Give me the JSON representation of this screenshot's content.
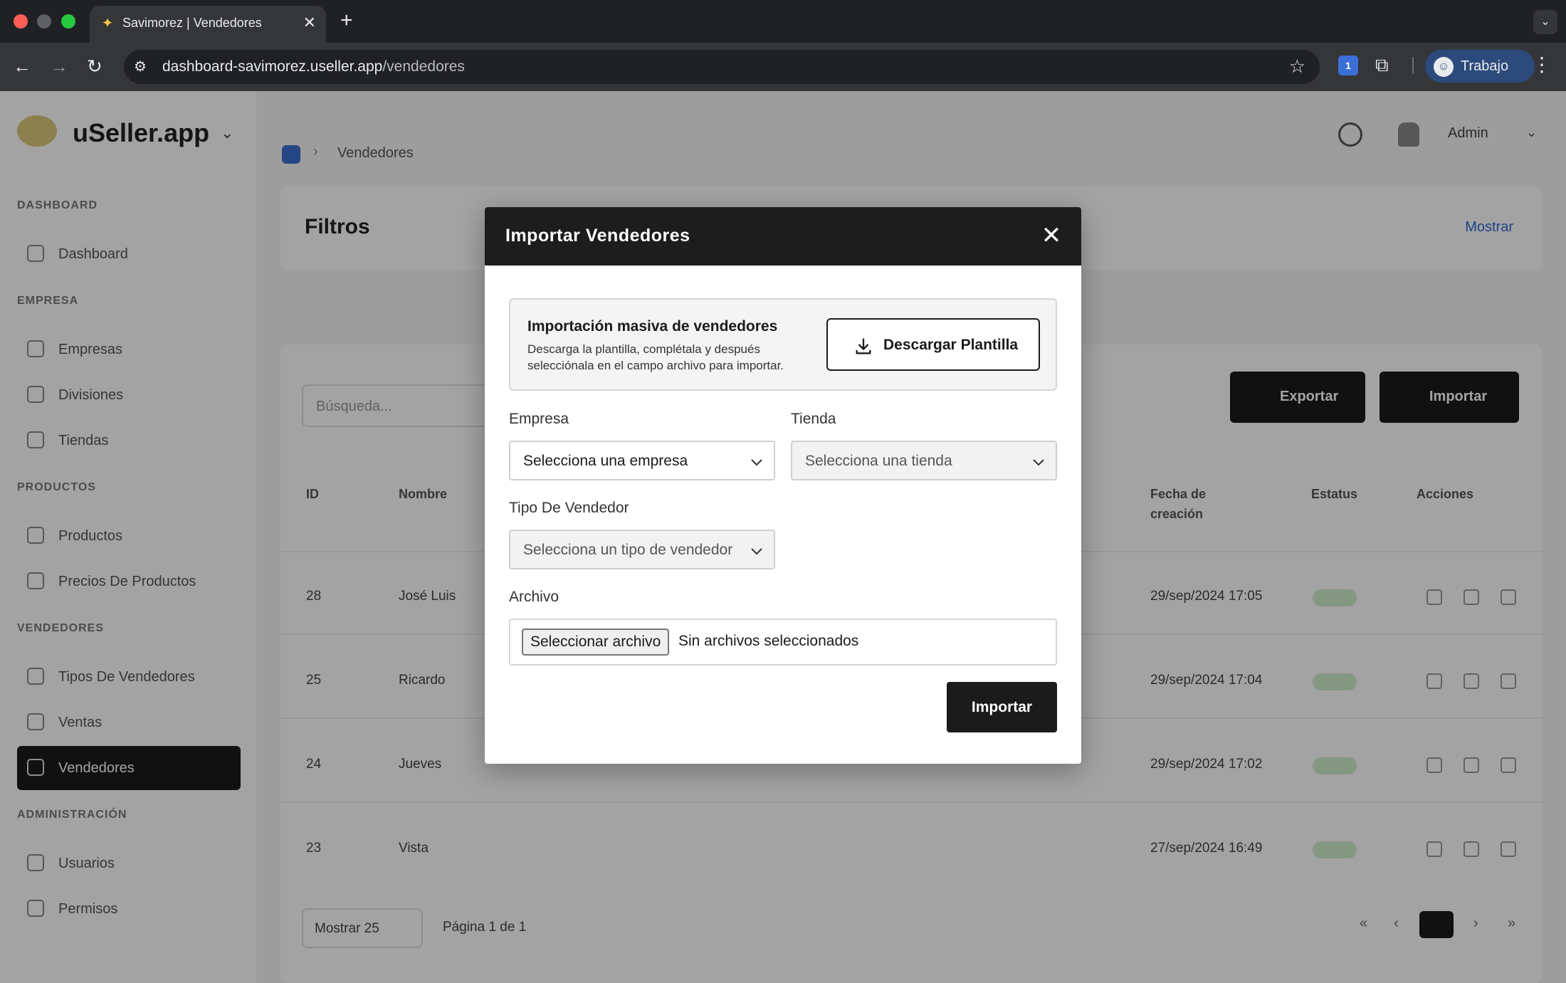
{
  "browser": {
    "tab_title": "Savimorez | Vendedores",
    "tab_close": "✕",
    "new_tab": "+",
    "url_host": "dashboard-savimorez.useller.app",
    "url_path": "/vendedores",
    "profile_label": "Trabajo",
    "extension_badge": "1"
  },
  "app": {
    "brand": "uSeller.app",
    "sidebar": {
      "sections": [
        "DASHBOARD",
        "EMPRESA",
        "PRODUCTOS",
        "VENDEDORES",
        "ADMINISTRACIÓN"
      ],
      "items": [
        {
          "label": "Dashboard"
        },
        {
          "label": "Empresas"
        },
        {
          "label": "Divisiones"
        },
        {
          "label": "Tiendas"
        },
        {
          "label": "Productos"
        },
        {
          "label": "Precios De Productos"
        },
        {
          "label": "Tipos De Vendedores"
        },
        {
          "label": "Ventas"
        },
        {
          "label": "Vendedores"
        },
        {
          "label": "Usuarios"
        },
        {
          "label": "Permisos"
        }
      ]
    },
    "topbar_user": "Admin",
    "breadcrumb": "Vendedores",
    "filters_title": "Filtros",
    "filters_toggle": "Mostrar",
    "search_placeholder": "Búsqueda...",
    "export_label": "Exportar",
    "import_label": "Importar",
    "table": {
      "headers": [
        "ID",
        "Nombre",
        "Fecha de creación",
        "Estatus",
        "Acciones"
      ],
      "rows": [
        {
          "id": "28",
          "name": "José Luis",
          "date": "29/sep/2024 17:05"
        },
        {
          "id": "25",
          "name": "Ricardo",
          "date": "29/sep/2024 17:04"
        },
        {
          "id": "24",
          "name": "Jueves",
          "date": "29/sep/2024 17:02"
        },
        {
          "id": "23",
          "name": "Vista",
          "date": "27/sep/2024 16:49"
        }
      ]
    },
    "pagination": {
      "page_size": "Mostrar 25",
      "info": "Página 1 de 1"
    }
  },
  "modal": {
    "title": "Importar Vendedores",
    "close_label": "✕",
    "info": {
      "title": "Importación masiva de vendedores",
      "text": "Descarga la plantilla, complétala y después selecciónala en el campo archivo para importar.",
      "download_label": "Descargar Plantilla"
    },
    "empresa": {
      "label": "Empresa",
      "value": "Selecciona una empresa"
    },
    "tienda": {
      "label": "Tienda",
      "value": "Selecciona una tienda"
    },
    "tipo": {
      "label": "Tipo De Vendedor",
      "value": "Selecciona un tipo de vendedor"
    },
    "archivo": {
      "label": "Archivo",
      "button": "Seleccionar archivo",
      "status": "Sin archivos seleccionados"
    },
    "submit_label": "Importar"
  }
}
